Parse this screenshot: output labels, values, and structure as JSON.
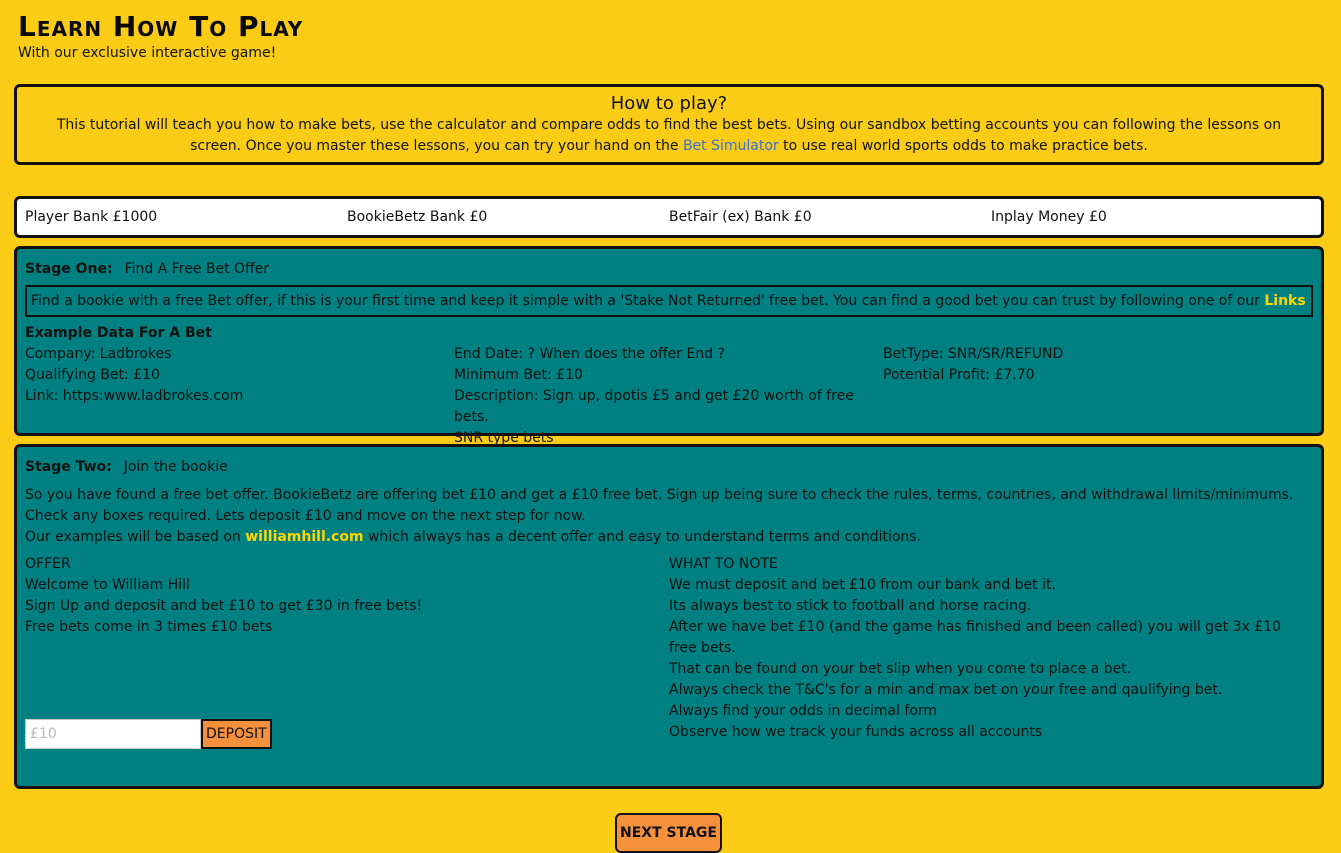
{
  "header": {
    "title": "Learn How To Play",
    "subtitle": "With our exclusive interactive game!"
  },
  "howto": {
    "heading": "How to play?",
    "text_before": "This tutorial will teach you how to make bets, use the calculator and compare odds to find the best bets. Using our sandbox betting accounts you can following the lessons on screen. Once you master these lessons, you can try your hand on the ",
    "link": "Bet Simulator",
    "text_after": " to use real world sports odds to make practice bets."
  },
  "banks": {
    "player": "Player Bank £1000",
    "bookie": "BookieBetz Bank £0",
    "betfair": "BetFair (ex) Bank £0",
    "inplay": "Inplay Money £0"
  },
  "stage_one": {
    "label": "Stage One:",
    "title": "Find A Free Bet Offer",
    "instruction": "Find a bookie with a free Bet offer, if this is your first time and keep it simple with a 'Stake Not Returned' free bet. You can find a good bet you can trust by following one of our ",
    "link": "Links",
    "example_title": "Example Data For A Bet",
    "col1": [
      "Company: Ladbrokes",
      "Qualifying Bet: £10",
      "Link: https:www.ladbrokes.com"
    ],
    "col2": [
      "End Date: ? When does the offer End ?",
      "Minimum Bet: £10",
      "Description: Sign up, dpotis £5 and get £20 worth of free bets.",
      "SNR type bets"
    ],
    "col3": [
      "BetType: SNR/SR/REFUND",
      "Potential Profit: £7.70"
    ]
  },
  "stage_two": {
    "label": "Stage Two:",
    "title": "Join the bookie",
    "para1": "So you have found a free bet offer. BookieBetz are offering bet £10 and get a £10 free bet. Sign up being sure to check the rules, terms, countries, and withdrawal limits/minimums. Check any boxes required. Lets deposit £10 and move on the next step for now.",
    "para2_before": "Our examples will be based on ",
    "para2_link": "williamhill.com",
    "para2_after": " which always has a decent offer and easy to understand terms and conditions.",
    "offer": [
      "OFFER",
      "Welcome to William Hill",
      "Sign Up and deposit and bet £10 to get £30 in free bets!",
      "Free bets come in 3 times £10 bets"
    ],
    "notes": [
      "WHAT TO NOTE",
      "We must deposit and bet £10 from our bank and bet it.",
      "Its always best to stick to football and horse racing.",
      "After we have bet £10 (and the game has finished and been called) you will get 3x £10 free bets.",
      "That can be found on your bet slip when you come to place a bet.",
      "Always check the T&C's for a min and max bet on your free and qaulifying bet.",
      "Always find your odds in decimal form",
      "Observe how we track your funds across all accounts"
    ],
    "deposit_placeholder": "£10",
    "deposit_label": "DEPOSIT"
  },
  "next_label": "NEXT STAGE"
}
